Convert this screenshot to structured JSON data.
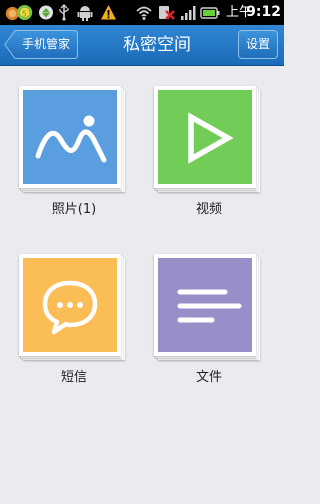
{
  "status_bar": {
    "time_prefix": "上午",
    "time": "9:12"
  },
  "title_bar": {
    "back_label": "手机管家",
    "title": "私密空间",
    "settings_label": "设置"
  },
  "tiles": [
    {
      "label": "照片(1)",
      "icon": "photo-icon",
      "color": "#5b9ee0"
    },
    {
      "label": "视频",
      "icon": "play-icon",
      "color": "#72cc58"
    },
    {
      "label": "短信",
      "icon": "message-icon",
      "color": "#fbbd56"
    },
    {
      "label": "文件",
      "icon": "document-icon",
      "color": "#9a8ec8"
    }
  ]
}
